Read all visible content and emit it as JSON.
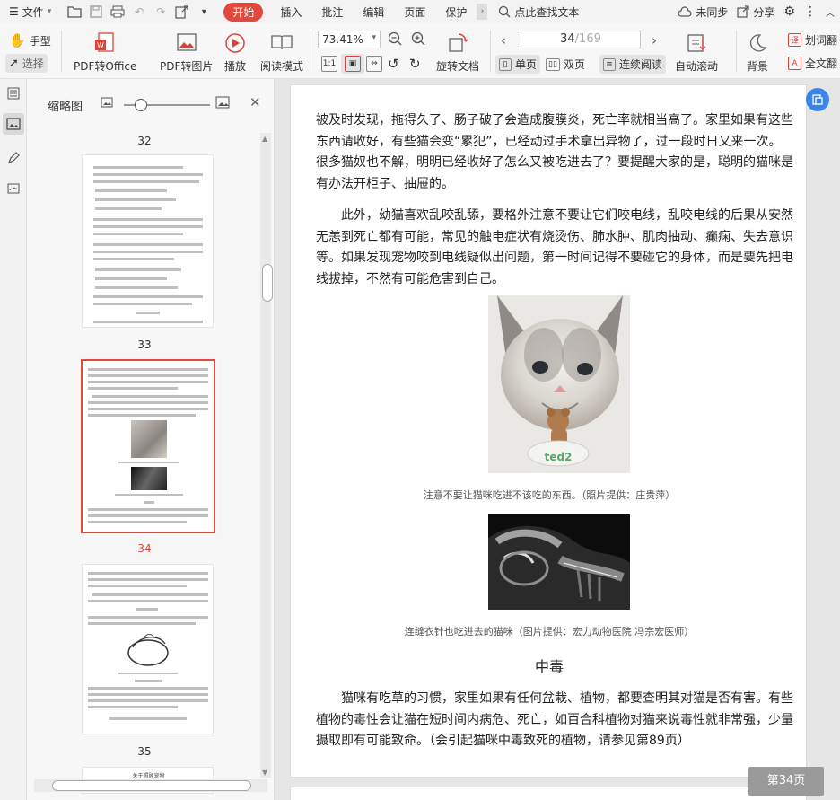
{
  "menubar": {
    "file_label": "文件",
    "tabs": [
      "开始",
      "插入",
      "批注",
      "编辑",
      "页面",
      "保护"
    ],
    "search_label": "点此查找文本",
    "sync_label": "未同步",
    "share_label": "分享"
  },
  "toolbar": {
    "hand_label": "手型",
    "select_label": "选择",
    "pdf_to_office": "PDF转Office",
    "pdf_to_image": "PDF转图片",
    "play": "播放",
    "read_mode": "阅读模式",
    "zoom": "73.41%",
    "rotate_doc": "旋转文档",
    "page_current": "34",
    "page_total": "/169",
    "single_page": "单页",
    "double_page": "双页",
    "continuous_read": "连续阅读",
    "auto_scroll": "自动滚动",
    "background": "背景",
    "word_lookup": "划词翻",
    "full_text": "全文翻"
  },
  "thumbnails": {
    "title": "缩略图",
    "pages": [
      {
        "num": "32"
      },
      {
        "num": "33"
      },
      {
        "num": "34"
      },
      {
        "num": "35"
      }
    ],
    "thumb35_title": "关于照顾宠物"
  },
  "document": {
    "para1": "被及时发现，拖得久了、肠子破了会造成腹膜炎，死亡率就相当高了。家里如果有这些东西请收好，有些猫会变“累犯”，已经动过手术拿出异物了，过一段时日又来一次。很多猫奴也不解，明明已经收好了怎么又被吃进去了？要提醒大家的是，聪明的猫咪是有办法开柜子、抽屉的。",
    "para2": "此外，幼猫喜欢乱咬乱舔，要格外注意不要让它们咬电线，乱咬电线的后果从安然无恙到死亡都有可能，常见的触电症状有烧烫伤、肺水肿、肌肉抽动、癫痫、失去意识等。如果发现宠物咬到电线疑似出问题，第一时间记得不要碰它的身体，而是要先把电线拔掉，不然有可能危害到自己。",
    "caption1": "注意不要让猫咪吃进不该吃的东西。（照片提供：庄贵萍）",
    "caption2": "连缝衣针也吃进去的猫咪（图片提供：宏力动物医院  冯宗宏医师）",
    "heading": "中毒",
    "para3": "猫咪有吃草的习惯，家里如果有任何盆栽、植物，都要查明其对猫是否有害。有些植物的毒性会让猫在短时间内病危、死亡，如百合科植物对猫来说毒性就非常强，少量摄取即有可能致命。（会引起猫咪中毒致死的植物，请参见第89页）",
    "toy_text": "ted2",
    "page_badge": "第34页"
  },
  "colors": {
    "accent": "#e2483b",
    "blue": "#3a86e8"
  }
}
